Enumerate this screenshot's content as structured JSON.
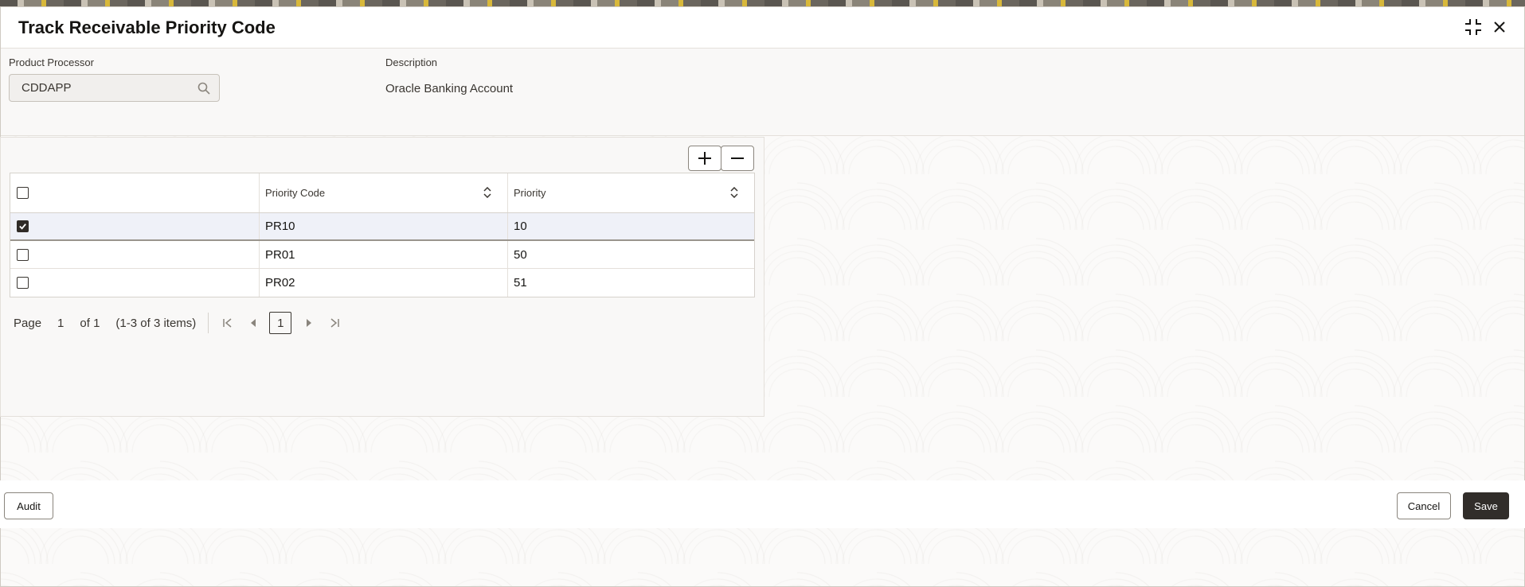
{
  "dialog": {
    "title": "Track Receivable Priority Code"
  },
  "header_fields": {
    "product_processor_label": "Product Processor",
    "product_processor_value": "CDDAPP",
    "description_label": "Description",
    "description_value": "Oracle Banking Account"
  },
  "table": {
    "columns": [
      "",
      "Priority Code",
      "Priority"
    ],
    "rows": [
      {
        "checked": true,
        "priority_code": "PR10",
        "priority": "10"
      },
      {
        "checked": false,
        "priority_code": "PR01",
        "priority": "50"
      },
      {
        "checked": false,
        "priority_code": "PR02",
        "priority": "51"
      }
    ]
  },
  "pager": {
    "page_label": "Page",
    "current_page": "1",
    "of_label": "of 1",
    "items_label": "(1-3 of 3 items)",
    "page_button": "1"
  },
  "footer": {
    "audit_label": "Audit",
    "cancel_label": "Cancel",
    "save_label": "Save"
  },
  "icons": {
    "collapse": "collapse-icon",
    "close": "close-icon",
    "search": "search-icon",
    "add": "plus-icon",
    "remove": "minus-icon",
    "sort": "sort-icon",
    "first": "first-page-icon",
    "prev": "previous-page-icon",
    "next": "next-page-icon",
    "last": "last-page-icon"
  },
  "colors": {
    "primary_button": "#312d2a",
    "selected_row": "#eff1f8"
  }
}
